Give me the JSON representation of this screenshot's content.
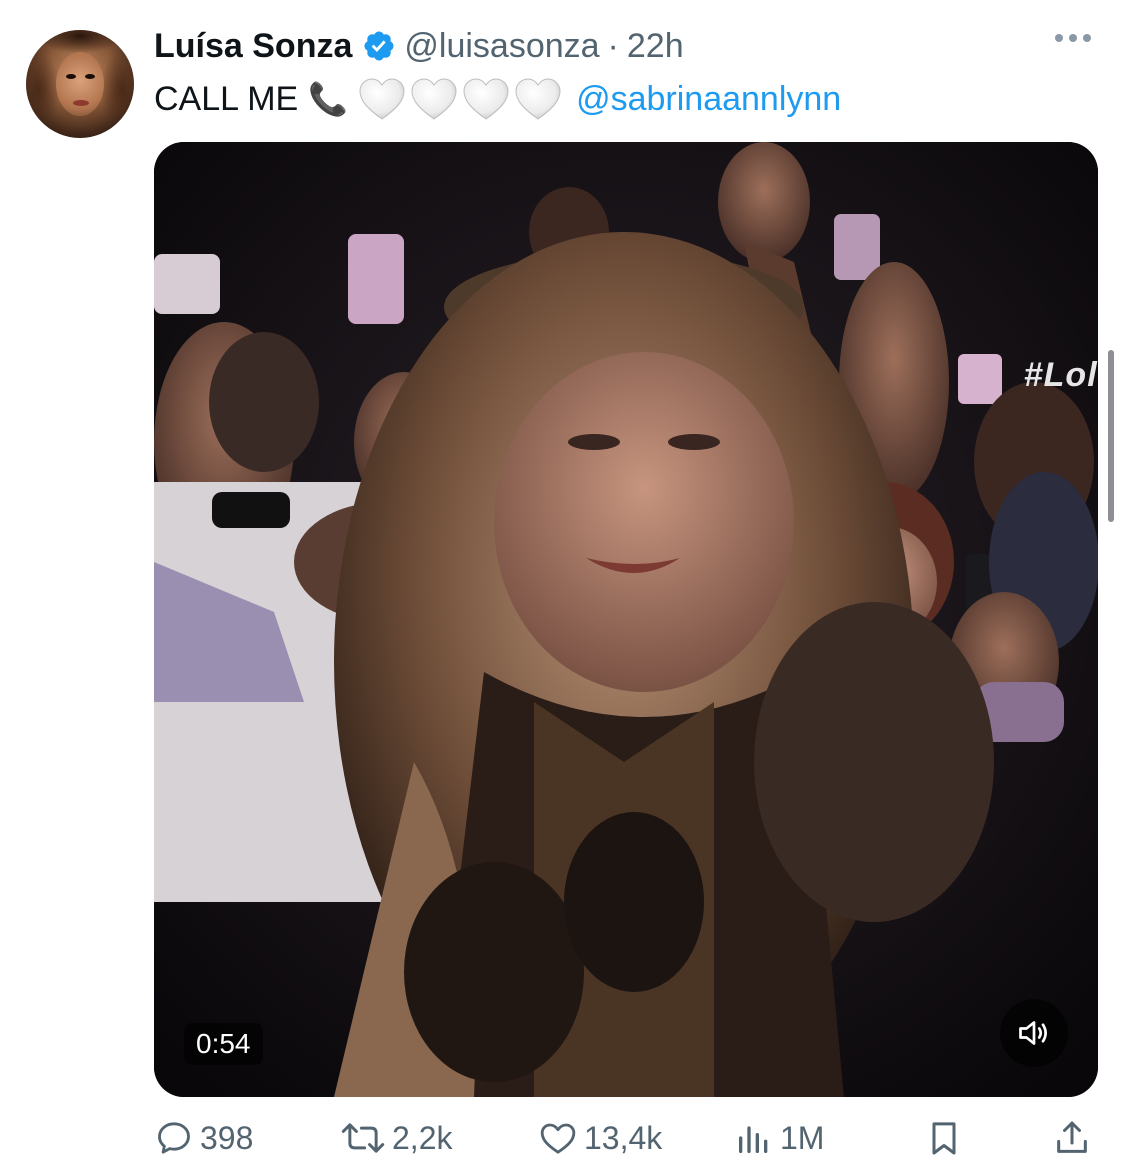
{
  "tweet": {
    "author_name": "Luísa Sonza",
    "handle": "@luisasonza",
    "separator": "·",
    "time": "22h",
    "text": "CALL ME",
    "emoji_phone": "📞",
    "heart_count": 4,
    "mention": "@sabrinaannlynn",
    "verified_color": "#1d9bf0"
  },
  "media": {
    "type": "video",
    "watermark": "#Lolla",
    "duration": "0:54",
    "sound_icon": "volume-icon"
  },
  "actions": {
    "replies": "398",
    "reposts": "2,2k",
    "likes": "13,4k",
    "views": "1M"
  },
  "colors": {
    "accent": "#1d9bf0",
    "secondary_text": "#536471"
  }
}
